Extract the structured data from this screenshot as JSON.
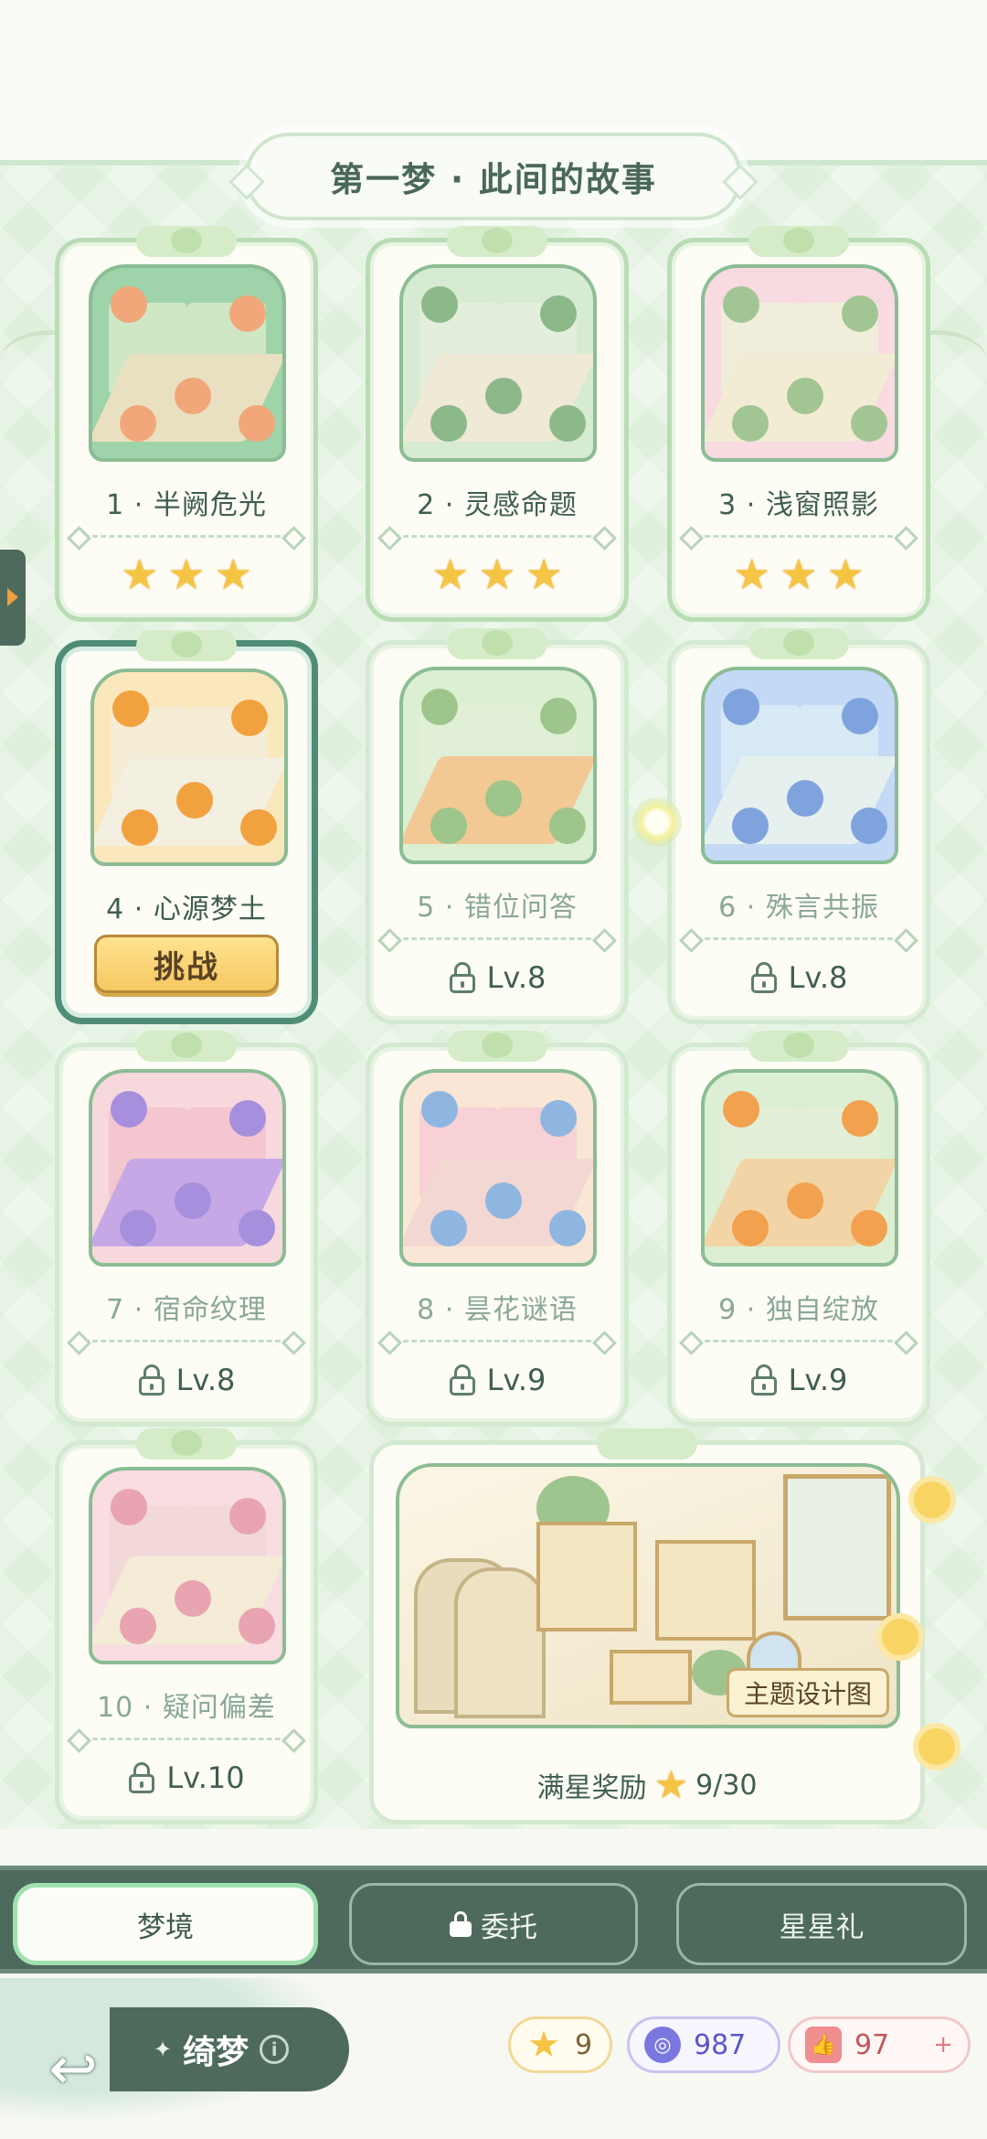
{
  "chapter_title": "第一梦 · 此间的故事",
  "levels": [
    {
      "name": "1 · 半阙危光",
      "state": "cleared",
      "stars": 3,
      "thumb": {
        "bg": "#9fd3a9",
        "floor": "#e9e0c1",
        "wall": "#cfe7c5",
        "accent": "#f1a77a"
      }
    },
    {
      "name": "2 · 灵感命题",
      "state": "cleared",
      "stars": 3,
      "thumb": {
        "bg": "#d7ead2",
        "floor": "#efe9d6",
        "wall": "#e3eedc",
        "accent": "#8cb98a"
      }
    },
    {
      "name": "3 · 浅窗照影",
      "state": "cleared",
      "stars": 3,
      "thumb": {
        "bg": "#f7dbe1",
        "floor": "#f3ecd4",
        "wall": "#f0eedb",
        "accent": "#a2c594"
      }
    },
    {
      "name": "4 · 心源梦土",
      "state": "current",
      "button": "挑战",
      "thumb": {
        "bg": "#fae7bc",
        "floor": "#f3efe1",
        "wall": "#f6edd7",
        "accent": "#f1a23f"
      }
    },
    {
      "name": "5 · 错位问答",
      "state": "locked",
      "requirement": "Lv.8",
      "thumb": {
        "bg": "#dcefd2",
        "floor": "#f2c894",
        "wall": "#e1efd6",
        "accent": "#9ec58b"
      }
    },
    {
      "name": "6 · 殊言共振",
      "state": "locked",
      "requirement": "Lv.8",
      "thumb": {
        "bg": "#c4d9f6",
        "floor": "#e6f1ef",
        "wall": "#d6e9f5",
        "accent": "#7fa3dd"
      }
    },
    {
      "name": "7 · 宿命纹理",
      "state": "locked",
      "requirement": "Lv.8",
      "thumb": {
        "bg": "#f7d8dd",
        "floor": "#c6a8e6",
        "wall": "#f4c6cf",
        "accent": "#a690dd"
      }
    },
    {
      "name": "8 · 昙花谜语",
      "state": "locked",
      "requirement": "Lv.9",
      "thumb": {
        "bg": "#f9e6d4",
        "floor": "#f2d7d3",
        "wall": "#f7d1d5",
        "accent": "#8fb6e0"
      }
    },
    {
      "name": "9 · 独自绽放",
      "state": "locked",
      "requirement": "Lv.9",
      "thumb": {
        "bg": "#dcefd2",
        "floor": "#f1d5a6",
        "wall": "#e2efd6",
        "accent": "#f2a14f"
      }
    },
    {
      "name": "10 · 疑问偏差",
      "state": "locked",
      "requirement": "Lv.10",
      "thumb": {
        "bg": "#f9dde1",
        "floor": "#f4ecd6",
        "wall": "#f3d8da",
        "accent": "#e8a4b0"
      }
    }
  ],
  "reward": {
    "tag": "主题设计图",
    "caption_prefix": "满星奖励",
    "progress": "9/30",
    "progress_value": 9,
    "progress_max": 30
  },
  "tabs": [
    {
      "label": "梦境",
      "active": true,
      "locked": false
    },
    {
      "label": "委托",
      "active": false,
      "locked": true
    },
    {
      "label": "星星礼",
      "active": false,
      "locked": false
    }
  ],
  "bottom": {
    "realm_label": "绮梦",
    "info_symbol": "i",
    "star_count": "9",
    "gem_count": "987",
    "like_count": "97"
  },
  "icons": {
    "star": "★",
    "back": "↩",
    "plus": "+",
    "gem": "◎",
    "like": "👍",
    "sparkle": "✦"
  },
  "colors": {
    "accent_green": "#4e6a5c",
    "star_gold": "#f6c443",
    "button_gold": "#f6c861",
    "gem_purple": "#5b55c9",
    "like_red": "#c0595a"
  }
}
